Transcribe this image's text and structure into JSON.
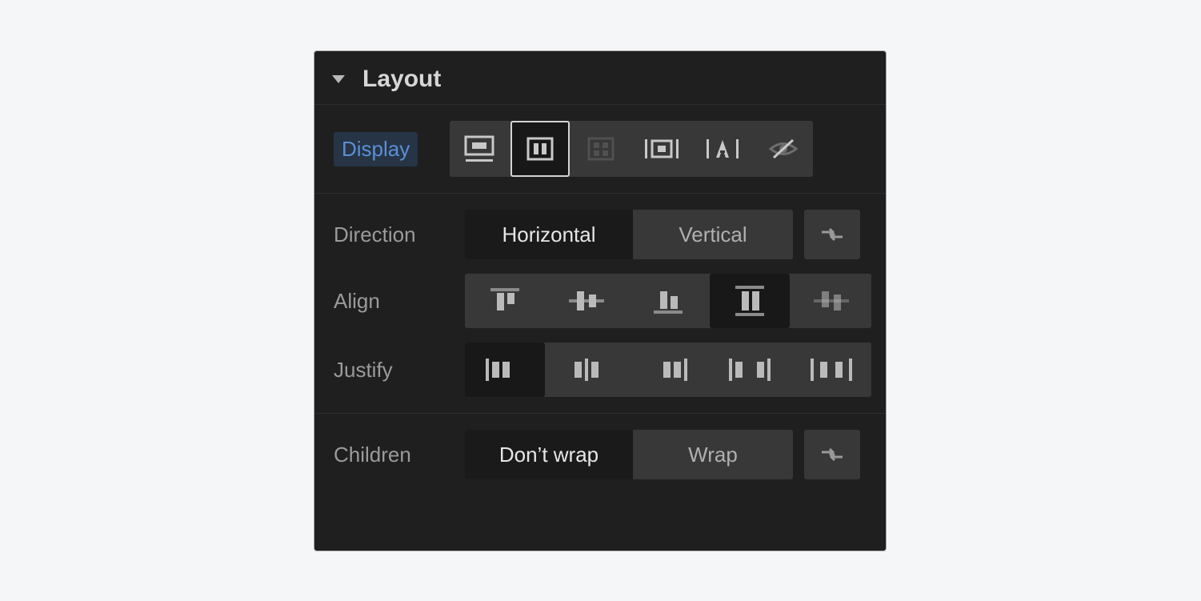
{
  "panel": {
    "title": "Layout"
  },
  "display": {
    "label": "Display"
  },
  "direction": {
    "label": "Direction",
    "options": [
      "Horizontal",
      "Vertical"
    ],
    "selected": 0
  },
  "align": {
    "label": "Align"
  },
  "justify": {
    "label": "Justify"
  },
  "children": {
    "label": "Children",
    "options": [
      "Don’t wrap",
      "Wrap"
    ],
    "selected": 0
  }
}
